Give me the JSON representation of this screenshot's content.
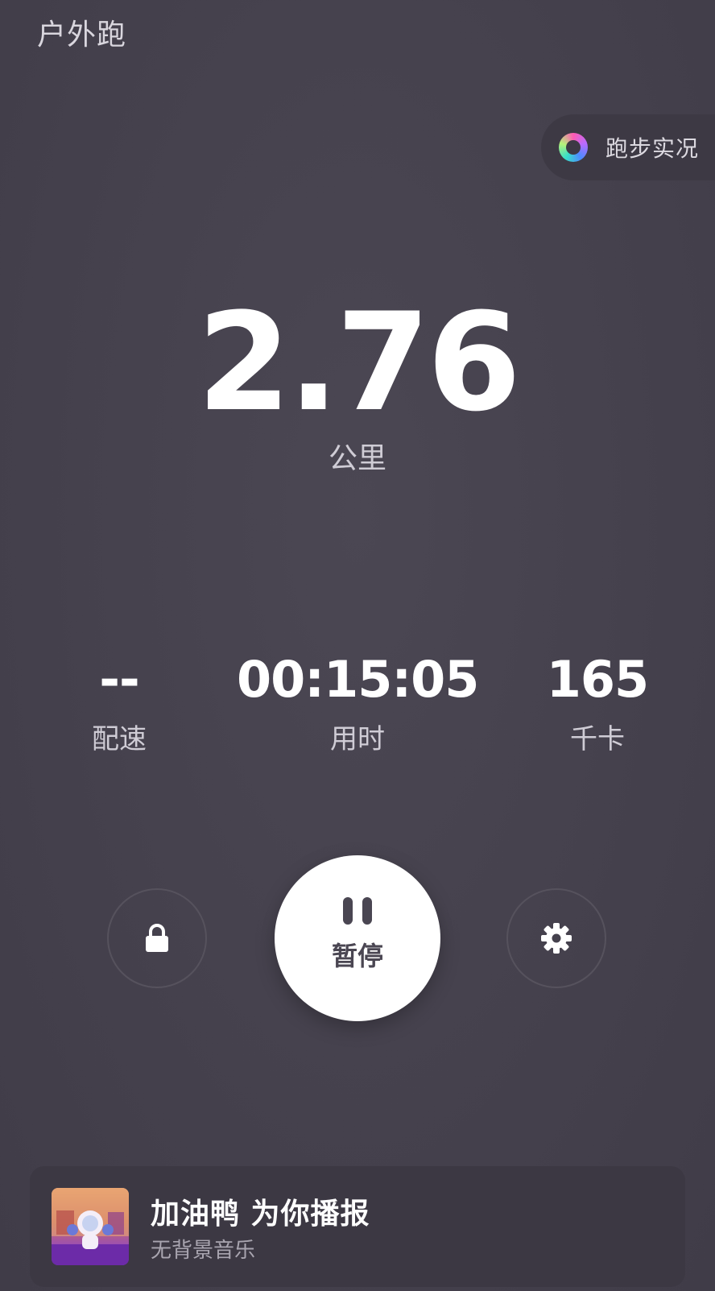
{
  "header": {
    "title": "户外跑",
    "live_button_label": "跑步实况"
  },
  "distance": {
    "value": "2.76",
    "unit": "公里"
  },
  "stats": [
    {
      "value": "--",
      "label": "配速"
    },
    {
      "value": "00:15:05",
      "label": "用时"
    },
    {
      "value": "165",
      "label": "千卡"
    }
  ],
  "controls": {
    "lock_icon": "lock-icon",
    "pause_label": "暂停",
    "settings_icon": "gear-icon"
  },
  "music": {
    "title": "加油鸭 为你播报",
    "subtitle": "无背景音乐"
  },
  "colors": {
    "background": "#45414d",
    "primary_text": "#ffffff",
    "secondary_text": "#cfccd5",
    "pause_button": "#ffffff"
  }
}
